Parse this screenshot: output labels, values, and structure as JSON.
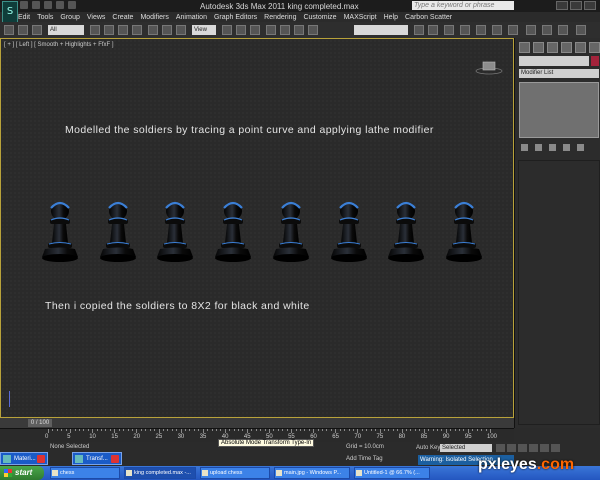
{
  "titlebar": {
    "title": "Autodesk 3ds Max  2011      king completed.max",
    "search_placeholder": "Type a keyword or phrase"
  },
  "menu": [
    "Edit",
    "Tools",
    "Group",
    "Views",
    "Create",
    "Modifiers",
    "Animation",
    "Graph Editors",
    "Rendering",
    "Customize",
    "MAXScript",
    "Help",
    "Carbon Scatter"
  ],
  "toolbar": {
    "selection_filter": "All",
    "ref_coord": "View"
  },
  "viewport": {
    "label": "[ + ] [ Left ] [ Smooth + Highlights + FfxF ]",
    "caption1": "Modelled the soldiers by tracing a point curve and applying lathe modifier",
    "caption2": "Then i copied the soldiers to 8X2 for black and white",
    "pawn_count": 8
  },
  "command_panel": {
    "modifier_list": "Modifier List"
  },
  "timeline": {
    "slider": "0 / 100",
    "ticks": [
      "0",
      "5",
      "10",
      "15",
      "20",
      "25",
      "30",
      "35",
      "40",
      "45",
      "50",
      "55",
      "60",
      "65",
      "70",
      "75",
      "80",
      "85",
      "90",
      "95",
      "100"
    ]
  },
  "status": {
    "none_selected": "None Selected",
    "tooltip": "Absolute Mode Transform Type-In",
    "grid": "Grid = 10.0cm",
    "add_time_tag": "Add Time Tag",
    "auto_key": "Auto Key",
    "selected": "Selected",
    "warning": "Warning: Isolated Selection"
  },
  "float_windows": [
    {
      "label": "Materi..."
    },
    {
      "label": "Transf..."
    }
  ],
  "taskbar": {
    "start": "start",
    "tasks": [
      "chess",
      "king completed.max -...",
      "upload chess",
      "main.jpg - Windows P...",
      "Untitled-1 @ 66.7% (..."
    ]
  },
  "watermark": {
    "text1": "pxleyes",
    "text2": ".com"
  },
  "colors": {
    "accent": "#b8a23a",
    "pawn_highlight": "#3b7fd6"
  }
}
